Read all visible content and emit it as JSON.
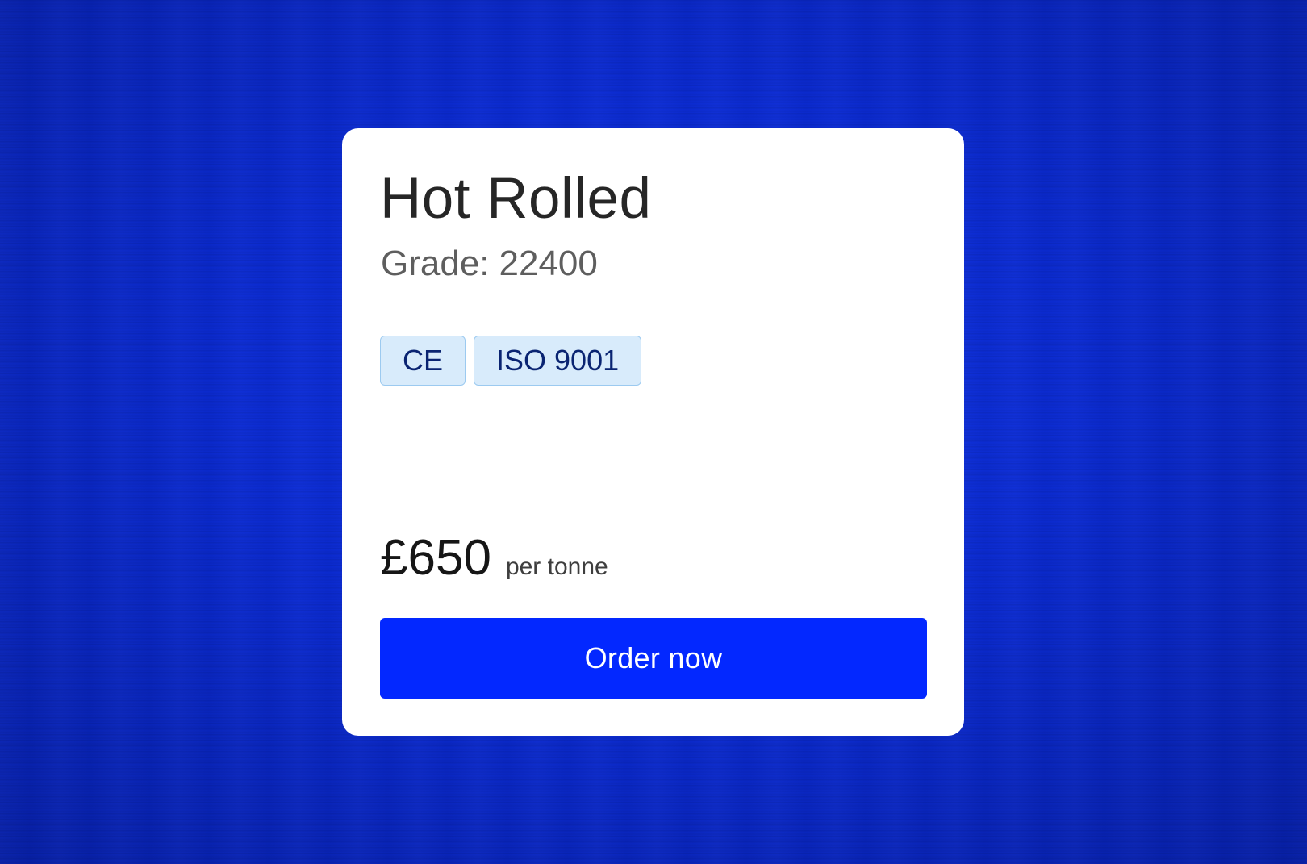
{
  "product": {
    "name": "Hot Rolled",
    "grade_label": "Grade:",
    "grade_value": "22400"
  },
  "badges": [
    "CE",
    "ISO 9001"
  ],
  "pricing": {
    "price": "£650",
    "unit": "per tonne"
  },
  "actions": {
    "order_label": "Order now"
  },
  "colors": {
    "background": "#0a2ad0",
    "card": "#ffffff",
    "badge_fill": "#d8ebfb",
    "badge_border": "#9ccaf0",
    "badge_text": "#0a2472",
    "button": "#0328ff",
    "button_text": "#ffffff"
  }
}
